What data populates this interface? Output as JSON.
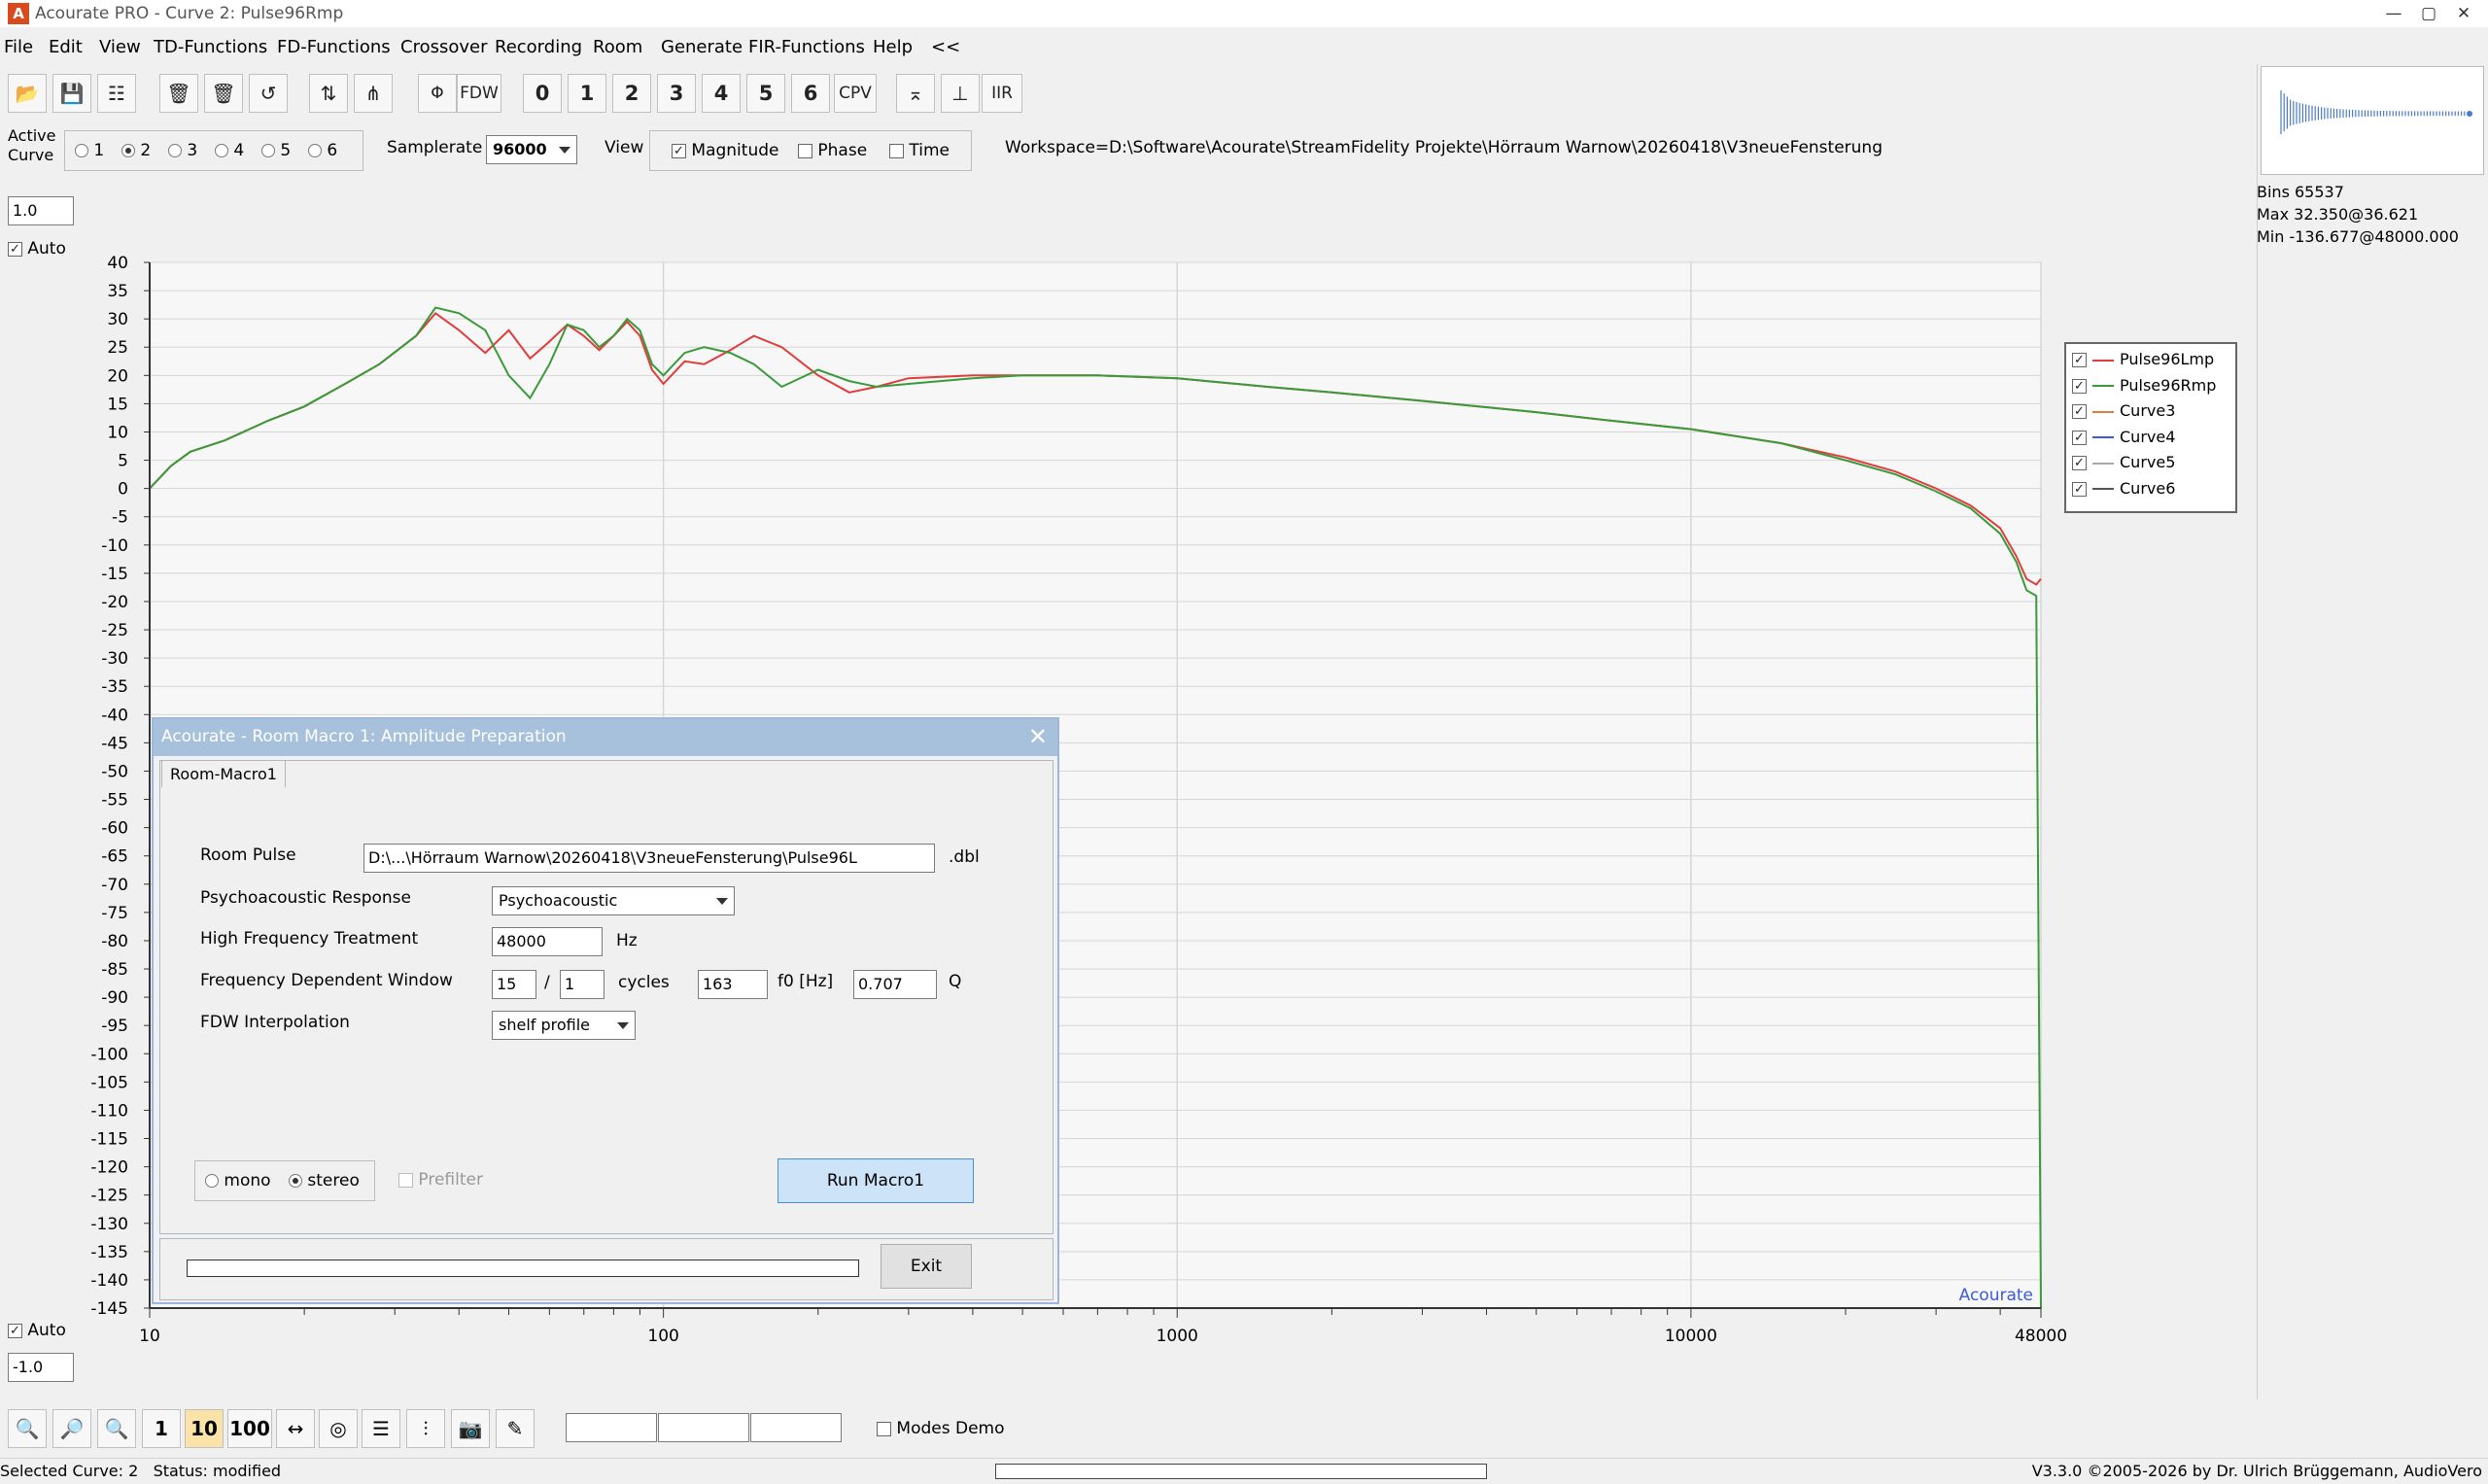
{
  "window": {
    "title": "Acourate PRO - Curve 2: Pulse96Rmp",
    "app_icon": "A"
  },
  "menu": [
    "File",
    "Edit",
    "View",
    "TD-Functions",
    "FD-Functions",
    "Crossover",
    "Recording",
    "Room",
    "Generate",
    "FIR-Functions",
    "Help",
    "<<"
  ],
  "toolbar": {
    "phase_label": "Φ",
    "fdw_label": "FDW",
    "numbers": [
      "0",
      "1",
      "2",
      "3",
      "4",
      "5",
      "6"
    ],
    "cpv_label": "CPV",
    "iir_label": "IIR"
  },
  "active_curve": {
    "label_line1": "Active",
    "label_line2": "Curve",
    "options": [
      "1",
      "2",
      "3",
      "4",
      "5",
      "6"
    ],
    "selected": "2"
  },
  "samplerate": {
    "label": "Samplerate",
    "value": "96000"
  },
  "view": {
    "label": "View",
    "magnitude": "Magnitude",
    "phase": "Phase",
    "time": "Time"
  },
  "workspace": {
    "label": "Workspace=",
    "path": "D:\\Software\\Acourate\\StreamFidelity Projekte\\Hörraum Warnow\\20260418\\V3neueFensterung"
  },
  "scale": {
    "top_value": "1.0",
    "bottom_value": "-1.0",
    "auto_label": "Auto"
  },
  "info": {
    "bins": "Bins 65537",
    "max": "Max 32.350@36.621",
    "min": "Min -136.677@48000.000"
  },
  "legend": [
    {
      "name": "Pulse96Lmp",
      "color": "#e03c3c"
    },
    {
      "name": "Pulse96Rmp",
      "color": "#3a9a3a"
    },
    {
      "name": "Curve3",
      "color": "#d98040"
    },
    {
      "name": "Curve4",
      "color": "#3c5ae0"
    },
    {
      "name": "Curve5",
      "color": "#aaaaaa"
    },
    {
      "name": "Curve6",
      "color": "#555555"
    }
  ],
  "watermark": "Acourate",
  "chart_data": {
    "type": "line",
    "x_scale": "log",
    "xlim": [
      10,
      48000
    ],
    "ylim": [
      -145,
      40
    ],
    "y_ticks": [
      40,
      35,
      30,
      25,
      20,
      15,
      10,
      5,
      0,
      -5,
      -10,
      -15,
      -20,
      -25,
      -30,
      -35,
      -40,
      -45,
      -50,
      -55,
      -60,
      -65,
      -70,
      -75,
      -80,
      -85,
      -90,
      -95,
      -100,
      -105,
      -110,
      -115,
      -120,
      -125,
      -130,
      -135,
      -140,
      -145
    ],
    "x_tick_labels": [
      "10",
      "100",
      "1000",
      "10000",
      "48000"
    ],
    "series": [
      {
        "name": "Pulse96Lmp",
        "color": "#e03c3c",
        "x": [
          10,
          11,
          12,
          14,
          17,
          20,
          24,
          28,
          33,
          36,
          40,
          45,
          50,
          55,
          60,
          65,
          70,
          75,
          80,
          85,
          90,
          95,
          100,
          110,
          120,
          135,
          150,
          170,
          200,
          230,
          260,
          300,
          400,
          500,
          700,
          1000,
          1500,
          2000,
          3000,
          5000,
          7000,
          10000,
          15000,
          20000,
          25000,
          30000,
          35000,
          40000,
          43000,
          45000,
          47000,
          48000
        ],
        "y": [
          0,
          4,
          6.5,
          8.5,
          12,
          14.5,
          18.5,
          22,
          27,
          31,
          28,
          24,
          28,
          23,
          26,
          29,
          27,
          24.5,
          27,
          29.5,
          27,
          21,
          18.5,
          22.5,
          22,
          24.5,
          27,
          25,
          20,
          17,
          18,
          19.5,
          20,
          20,
          20,
          19.5,
          18,
          17,
          15.5,
          13.5,
          12,
          10.5,
          8,
          5.5,
          3,
          0,
          -3,
          -7,
          -12,
          -16,
          -17,
          -16
        ]
      },
      {
        "name": "Pulse96Rmp",
        "color": "#3a9a3a",
        "x": [
          10,
          11,
          12,
          14,
          17,
          20,
          24,
          28,
          33,
          36,
          40,
          45,
          50,
          55,
          60,
          65,
          70,
          75,
          80,
          85,
          90,
          95,
          100,
          110,
          120,
          135,
          150,
          170,
          200,
          230,
          260,
          300,
          400,
          500,
          700,
          1000,
          1500,
          2000,
          3000,
          5000,
          7000,
          10000,
          15000,
          20000,
          25000,
          30000,
          35000,
          40000,
          43000,
          45000,
          47000,
          48000
        ],
        "y": [
          0,
          4,
          6.5,
          8.5,
          12,
          14.5,
          18.5,
          22,
          27,
          32,
          31,
          28,
          20,
          16,
          22,
          29,
          28,
          25,
          27,
          30,
          28,
          22,
          20,
          24,
          25,
          24,
          22,
          18,
          21,
          19,
          18,
          18.5,
          19.5,
          20,
          20,
          19.5,
          18,
          17,
          15.5,
          13.5,
          12,
          10.5,
          8,
          5,
          2.5,
          -0.5,
          -3.5,
          -8,
          -13,
          -18,
          -19,
          -145
        ]
      }
    ]
  },
  "dialog": {
    "title": "Acourate - Room Macro 1: Amplitude Preparation",
    "tab": "Room-Macro1",
    "room_pulse": {
      "label": "Room Pulse",
      "value": "D:\\...\\Hörraum Warnow\\20260418\\V3neueFensterung\\Pulse96L",
      "ext": ".dbl"
    },
    "psycho": {
      "label": "Psychoacoustic Response",
      "value": "Psychoacoustic"
    },
    "hf": {
      "label": "High Frequency Treatment",
      "value": "48000",
      "unit": "Hz"
    },
    "fdw": {
      "label": "Frequency Dependent Window",
      "cycles1": "15",
      "slash": "/",
      "cycles2": "1",
      "cycles_label": "cycles",
      "f0": "163",
      "f0_label": "f0 [Hz]",
      "q": "0.707",
      "q_label": "Q"
    },
    "fdw_interp": {
      "label": "FDW Interpolation",
      "value": "shelf profile"
    },
    "mono": "mono",
    "stereo": "stereo",
    "prefilter": "Prefilter",
    "run": "Run Macro1",
    "exit": "Exit"
  },
  "bottom_toolbar": {
    "b1": "1",
    "b10": "10",
    "b100": "100",
    "modes_demo": "Modes Demo"
  },
  "status": {
    "left": "Selected Curve: 2   Status: modified",
    "right": "V3.3.0 ©2005-2026 by Dr. Ulrich Brüggemann, AudioVero"
  }
}
